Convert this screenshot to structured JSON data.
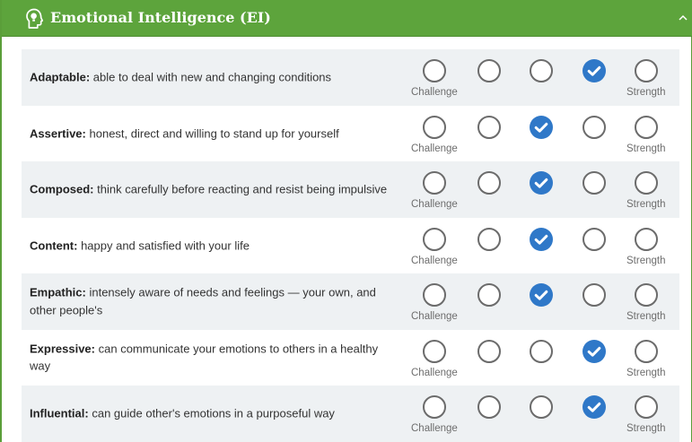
{
  "section": {
    "title": "Emotional Intelligence (EI)",
    "header_icon": "lightbulb-head-icon",
    "toggle_icon": "chevron-up-icon"
  },
  "colors": {
    "header_green": "#5da43c",
    "selected_blue": "#2f78c8",
    "alt_row": "#eef1f3"
  },
  "scale": {
    "left_label": "Challenge",
    "right_label": "Strength",
    "points": 5
  },
  "traits": [
    {
      "name": "Adaptable:",
      "description": "able to deal with new and changing conditions",
      "selected": 4
    },
    {
      "name": "Assertive:",
      "description": "honest, direct and willing to stand up for yourself",
      "selected": 3
    },
    {
      "name": "Composed:",
      "description": "think carefully before reacting and resist being impulsive",
      "selected": 3
    },
    {
      "name": "Content:",
      "description": "happy and satisfied with your life",
      "selected": 3
    },
    {
      "name": "Empathic:",
      "description": "intensely aware of needs and feelings — your own, and other people's",
      "selected": 3
    },
    {
      "name": "Expressive:",
      "description": "can communicate your emotions to others in a healthy way",
      "selected": 4
    },
    {
      "name": "Influential:",
      "description": "can guide other's emotions in a purposeful way",
      "selected": 4
    }
  ]
}
